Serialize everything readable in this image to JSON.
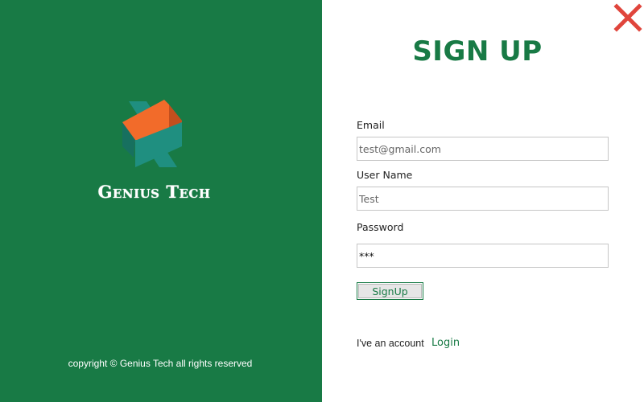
{
  "brand": {
    "name": "Genius Tech",
    "logo_icon": "genius-tech-logo-icon",
    "copyright": "copyright © Genius Tech all rights reserved"
  },
  "window": {
    "close_icon": "close-icon"
  },
  "form": {
    "title": "SIGN UP",
    "email": {
      "label": "Email",
      "value": "test@gmail.com"
    },
    "username": {
      "label": "User Name",
      "value": "Test"
    },
    "password": {
      "label": "Password",
      "value": "***"
    },
    "submit_label": "SignUp",
    "account_prompt": "I've an account",
    "login_label": "Login"
  },
  "colors": {
    "brand_green": "#187a45",
    "logo_orange": "#f26b2a",
    "logo_teal": "#1f8f80",
    "close_red": "#e0453c"
  }
}
